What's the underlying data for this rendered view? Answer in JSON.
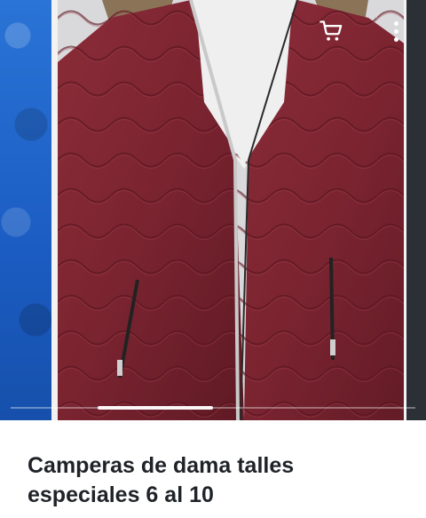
{
  "product": {
    "title": "Camperas de dama talles especiales 6 al 10"
  },
  "toolbar": {
    "cart_icon": "shopping-cart-icon",
    "more_icon": "more-vertical-icon"
  },
  "gallery": {
    "images": [
      {
        "name": "blue jacket",
        "color": "#1e63c9"
      },
      {
        "name": "burgundy jacket",
        "color": "#7a2430"
      },
      {
        "name": "black jacket",
        "color": "#2b2f36"
      }
    ],
    "active_index": 1
  }
}
